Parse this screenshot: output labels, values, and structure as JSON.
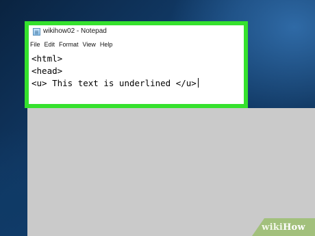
{
  "window": {
    "title": "wikihow02 - Notepad",
    "icon": "notepad-icon"
  },
  "menu": {
    "items": [
      {
        "label": "File"
      },
      {
        "label": "Edit"
      },
      {
        "label": "Format"
      },
      {
        "label": "View"
      },
      {
        "label": "Help"
      }
    ]
  },
  "editor": {
    "lines": [
      "<html>",
      "<head>",
      "<u> This text is underlined </u>"
    ]
  },
  "watermark": {
    "part1": "wiki",
    "part2": "How"
  },
  "colors": {
    "highlight": "#35e12d",
    "desktop": "#123d6c",
    "gray_area": "#cacaca"
  }
}
